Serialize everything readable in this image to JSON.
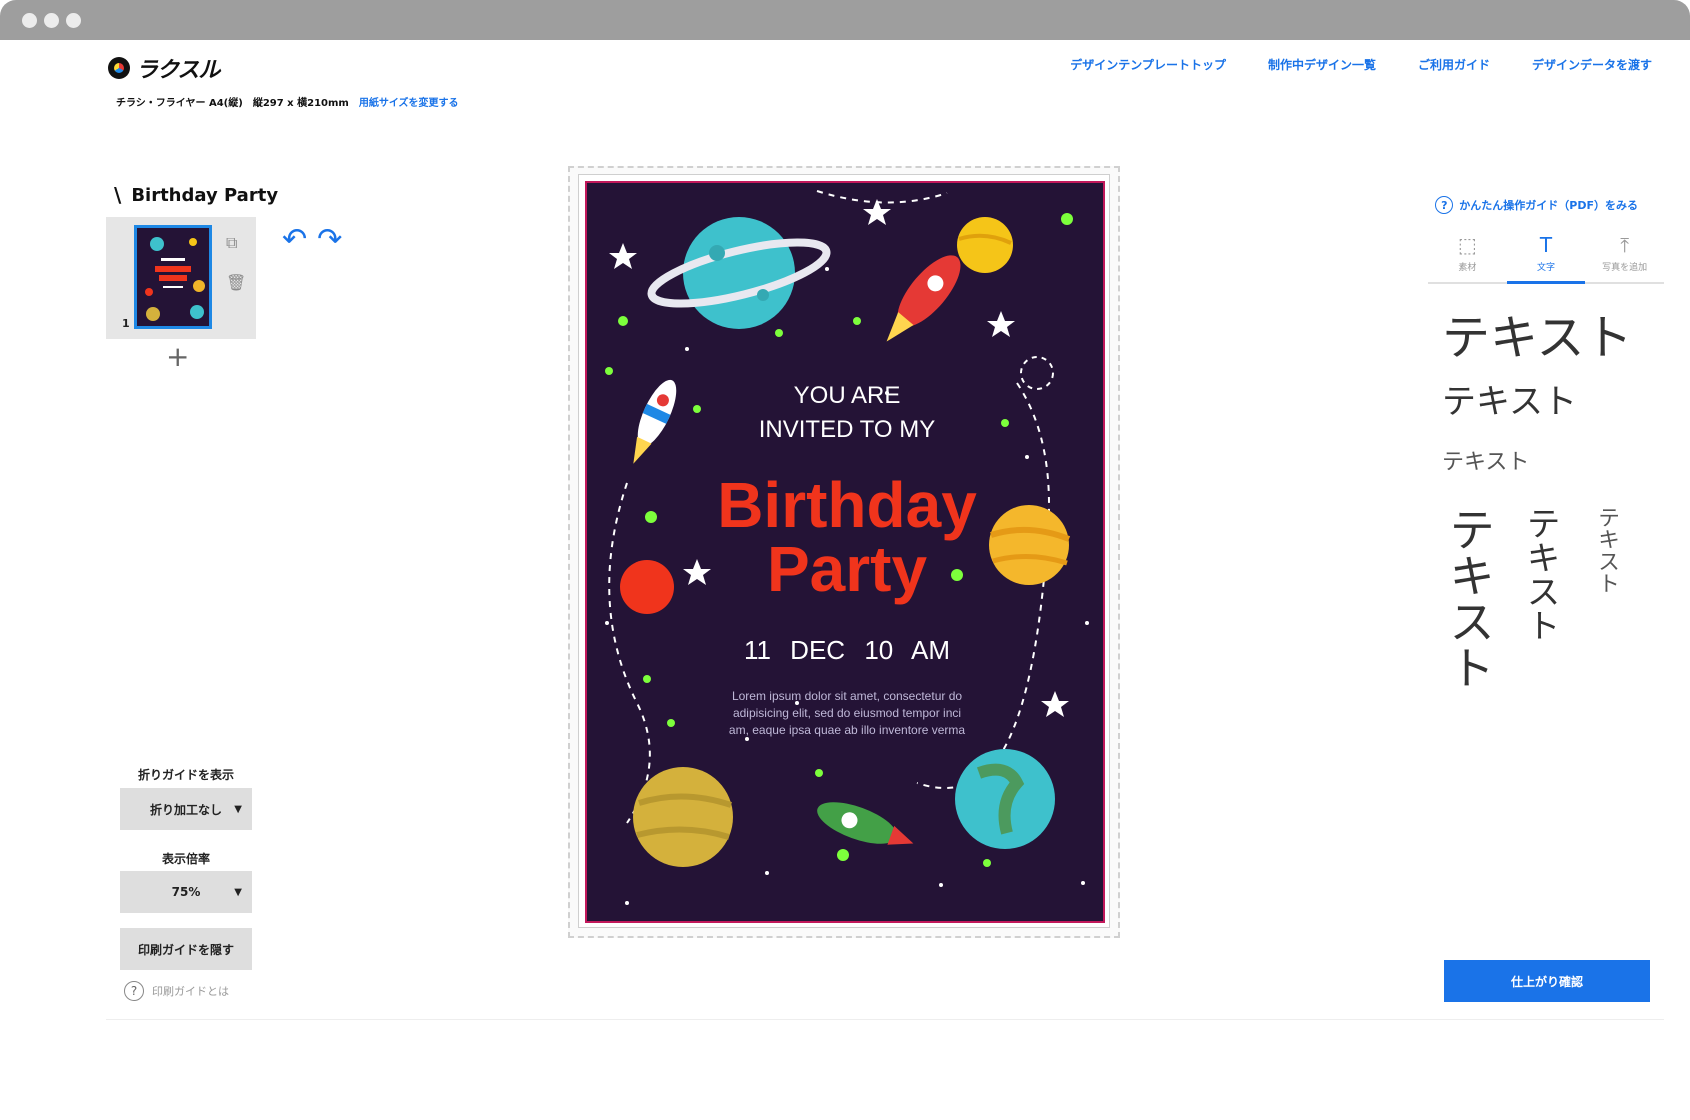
{
  "header": {
    "logo_text": "ラクスル",
    "product": "チラシ・フライヤー A4(縦)",
    "size": "縦297 x 横210mm",
    "change_size_link": "用紙サイズを変更する",
    "nav": [
      "デザインテンプレートトップ",
      "制作中デザイン一覧",
      "ご利用ガイド",
      "デザインデータを渡す"
    ]
  },
  "left_panel": {
    "design_title": "Birthday Party",
    "page_number": "1",
    "add_page": "+",
    "fold_guide_label": "折りガイドを表示",
    "fold_guide_value": "折り加工なし",
    "zoom_label": "表示倍率",
    "zoom_value": "75%",
    "hide_print_guide": "印刷ガイドを隠す",
    "print_guide_help": "印刷ガイドとは"
  },
  "flyer": {
    "invite_line1": "YOU ARE",
    "invite_line2": "INVITED TO MY",
    "title_line1": "Birthday",
    "title_line2": "Party",
    "date": "11 DEC",
    "time": "10 AM",
    "lorem": "Lorem ipsum dolor sit amet, consectetur do adipisicing elit, sed do eiusmod tempor inci am, eaque ipsa quae ab illo inventore verma",
    "colors": {
      "background": "#241336",
      "title": "#f0341c",
      "text": "#ffffff"
    }
  },
  "right_panel": {
    "pdf_guide": "かんたん操作ガイド（PDF）をみる",
    "tabs": [
      {
        "label": "素材",
        "icon": "shapes-icon"
      },
      {
        "label": "文字",
        "icon": "text-icon"
      },
      {
        "label": "写真を追加",
        "icon": "upload-icon"
      }
    ],
    "active_tab": "文字",
    "text_samples": [
      "テキスト",
      "テキスト",
      "テキスト"
    ],
    "vertical_samples": [
      "テキスト",
      "テキスト",
      "テキスト"
    ],
    "confirm_button": "仕上がり確認"
  },
  "accent_color": "#1a73e8"
}
